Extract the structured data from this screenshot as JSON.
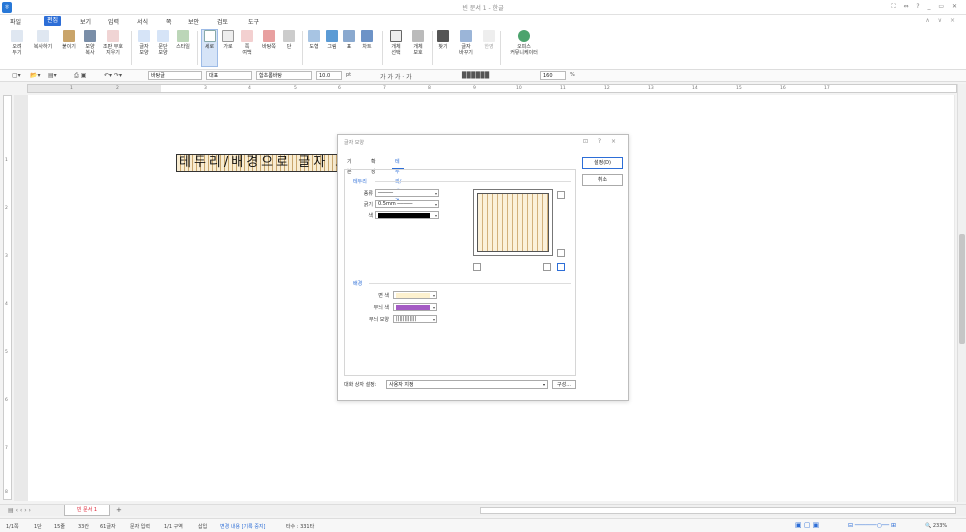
{
  "window": {
    "title": "빈 문서 1 - 한글",
    "controls": "⛶ ⇔ ? _ ▭ ✕"
  },
  "menu": {
    "items": [
      "파일",
      "편집",
      "보기",
      "입력",
      "서식",
      "쪽",
      "보안",
      "검토",
      "도구"
    ],
    "active": "편집",
    "right": "∧ ∨ ×"
  },
  "ribbon": {
    "buttons": [
      "오려\n두기",
      "복사하기",
      "붙이기",
      "모양\n복사",
      "조판 부호\n지우기",
      "글자\n모양",
      "문단\n모양",
      "스타일",
      "세로",
      "가로",
      "쪽\n여백",
      "바탕쪽",
      "단",
      "도형",
      "그림",
      "표",
      "차트",
      "개체\n선택",
      "개체\n보호",
      "찾기",
      "글자\n바꾸기",
      "한영",
      "오피스\n커뮤니케이터"
    ],
    "selected": "세로"
  },
  "format_bar": {
    "style": "바탕글",
    "lang": "대표",
    "font": "함초롬바탕",
    "size": "10.0",
    "unit": "pt",
    "zoom": "160",
    "zoom_unit": "%"
  },
  "ruler": {
    "numbers": [
      "1",
      "2",
      "3",
      "4",
      "5",
      "6",
      "7",
      "8",
      "9",
      "10",
      "11",
      "12",
      "13",
      "14",
      "15",
      "16",
      "17"
    ]
  },
  "vruler": {
    "numbers": [
      "1",
      "2",
      "3",
      "4",
      "5",
      "6",
      "7",
      "8"
    ]
  },
  "document": {
    "text": "테두리/배경으로 글자 모양"
  },
  "dialog": {
    "title": "글자 모양",
    "controls": "⊡ ? ×",
    "tabs": [
      "기본",
      "확장",
      "테두리/배경"
    ],
    "active_tab": "테두리/배경",
    "border": {
      "section_title": "테두리",
      "type_label": "종류",
      "type_value": "─────",
      "width_label": "굵기",
      "width_value": "0.5mm",
      "color_label": "색",
      "color_value": "#000000"
    },
    "background": {
      "section_title": "배경",
      "face_label": "면 색",
      "face_color": "#fdf1cf",
      "pattern_color_label": "무늬 색",
      "pattern_color": "#a45bc4",
      "pattern_shape_label": "무늬 모양",
      "pattern_shape": "||||||||||||"
    },
    "ok": "설정(D)",
    "cancel": "취소",
    "preset_label": "대화 상자 설정:",
    "preset_value": "사용자 지정",
    "config_button": "구성..."
  },
  "sheets": {
    "active": "빈 문서 1",
    "add": "+"
  },
  "status": {
    "items": [
      "1/1쪽",
      "1단",
      "15줄",
      "33칸",
      "61글자",
      "문자 입력",
      "1/1 구역",
      "삽입"
    ],
    "track_changes": "변경 내용 [기록 중지]",
    "keystrokes": "타수 : 331타",
    "zoom": "233%"
  }
}
